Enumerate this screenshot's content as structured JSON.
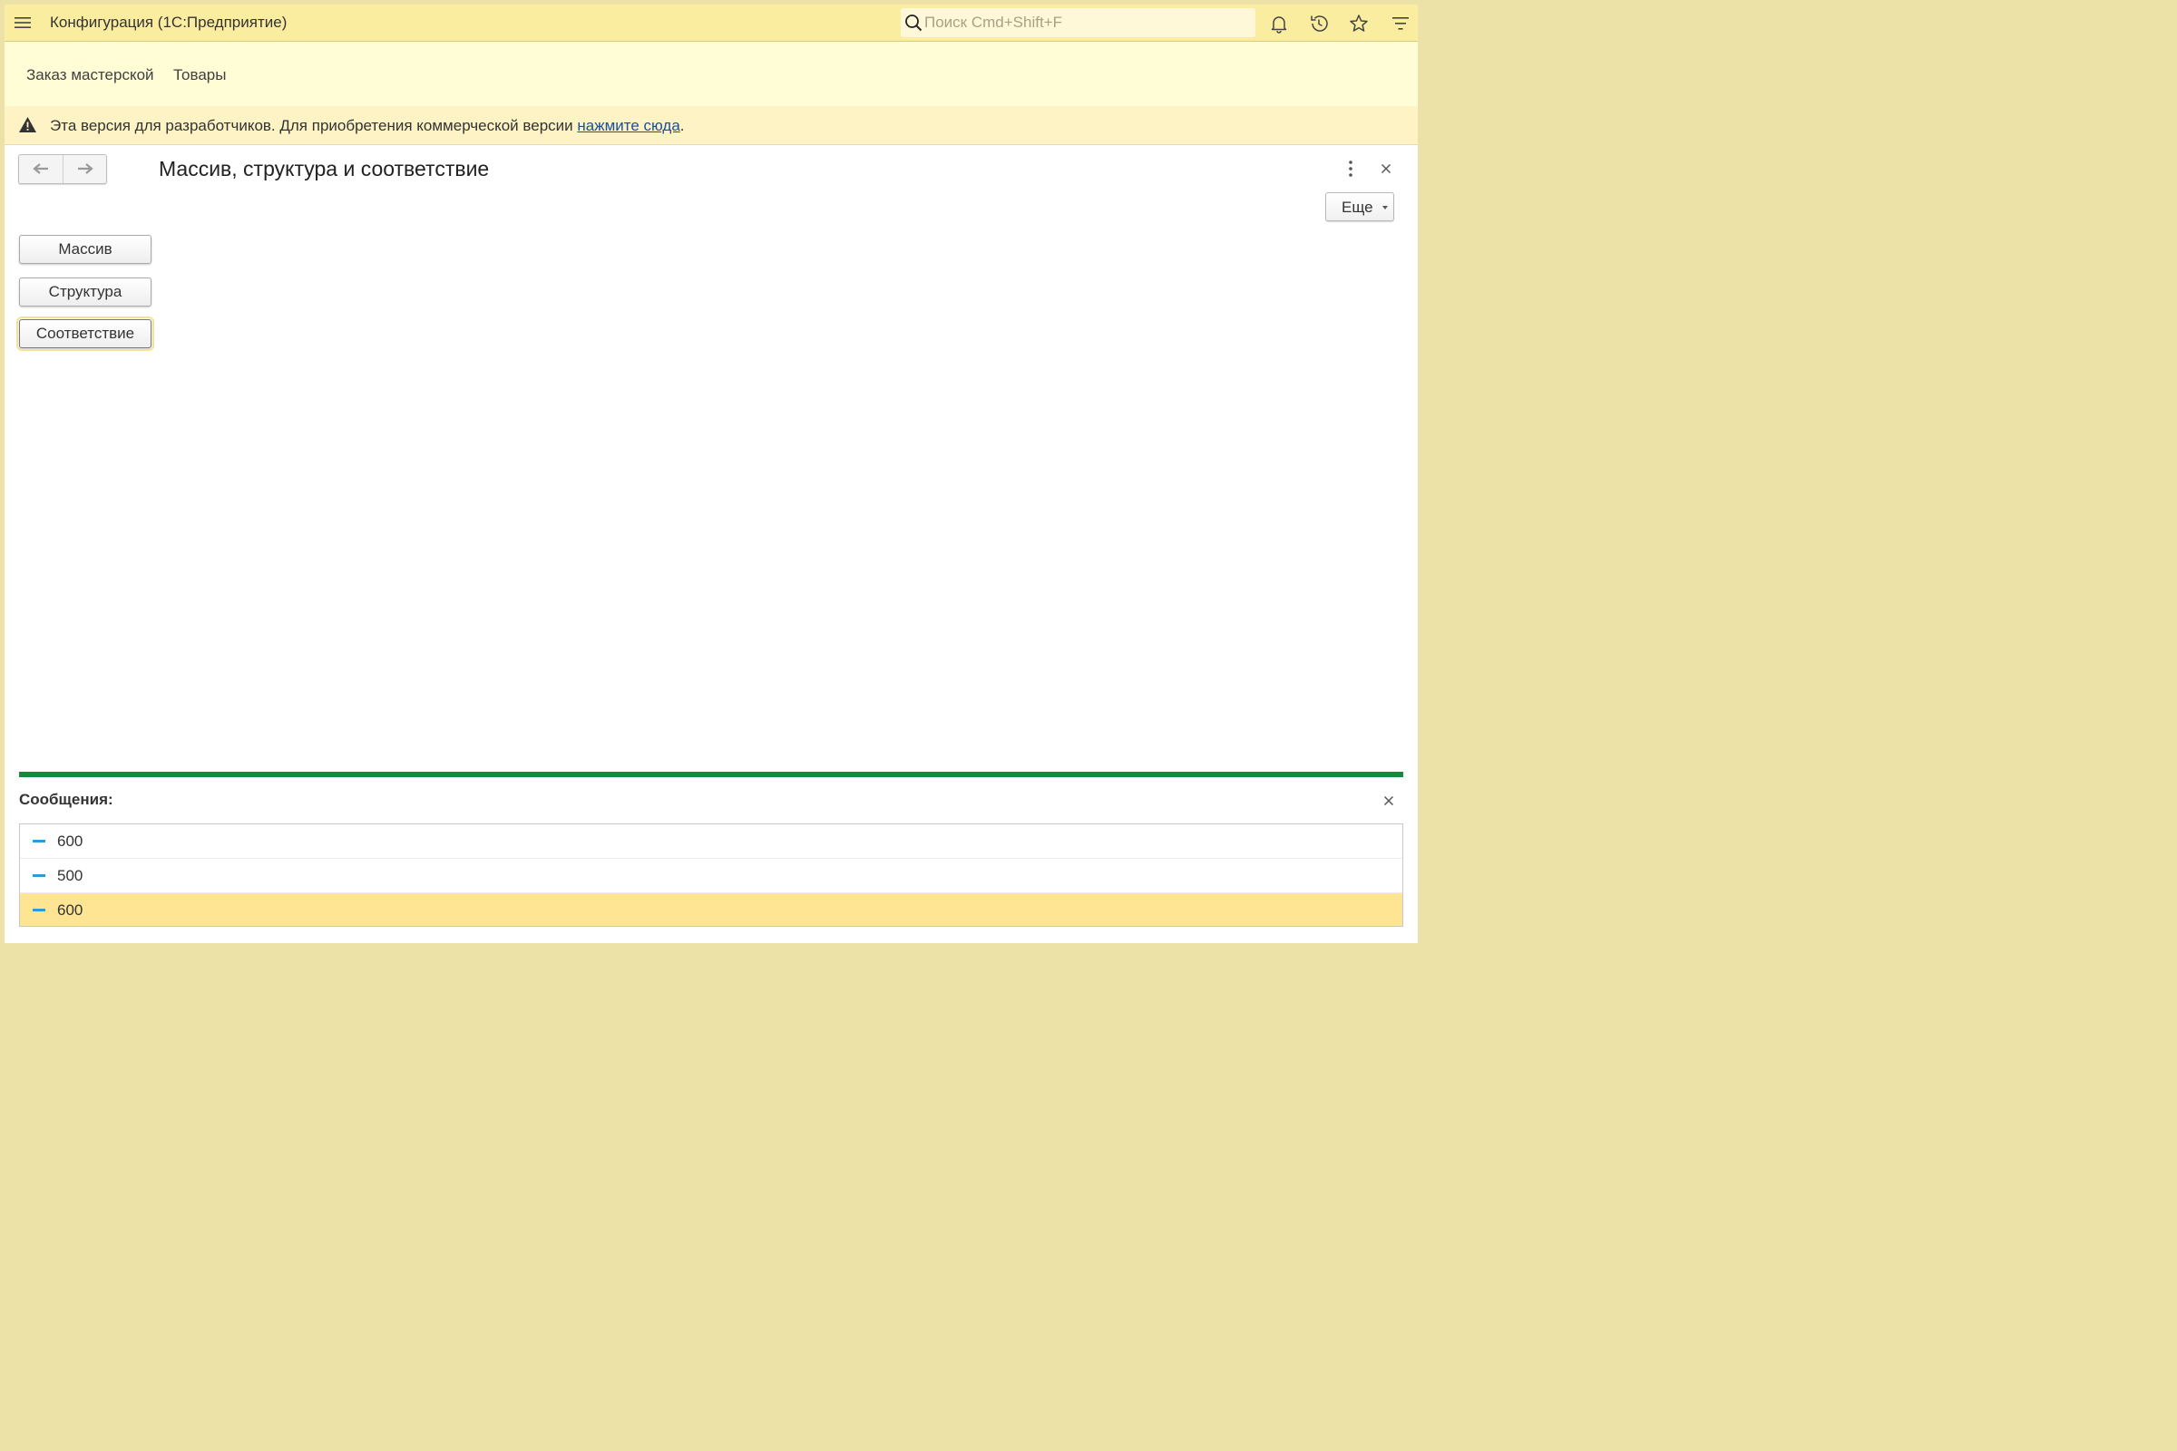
{
  "app": {
    "title": "Конфигурация  (1С:Предприятие)"
  },
  "search": {
    "placeholder": "Поиск Cmd+Shift+F"
  },
  "sections": [
    {
      "label": "Заказ мастерской"
    },
    {
      "label": "Товары"
    }
  ],
  "warning": {
    "text": "Эта версия для разработчиков. Для приобретения коммерческой версии ",
    "link": "нажмите сюда",
    "tail": "."
  },
  "form": {
    "title": "Массив, структура и соответствие",
    "more_label": "Еще",
    "buttons": [
      {
        "label": "Массив"
      },
      {
        "label": "Структура"
      },
      {
        "label": "Соответствие"
      }
    ]
  },
  "messages": {
    "title": "Сообщения:",
    "items": [
      {
        "text": "600"
      },
      {
        "text": "500"
      },
      {
        "text": "600"
      }
    ]
  },
  "colors": {
    "topbar": "#fbeda0",
    "sections_bg": "#fffdd6",
    "warning_bg": "#fdf3c4",
    "messages_accent": "#0f8c3c",
    "selected_row": "#fde594",
    "link": "#1a4fa0"
  }
}
